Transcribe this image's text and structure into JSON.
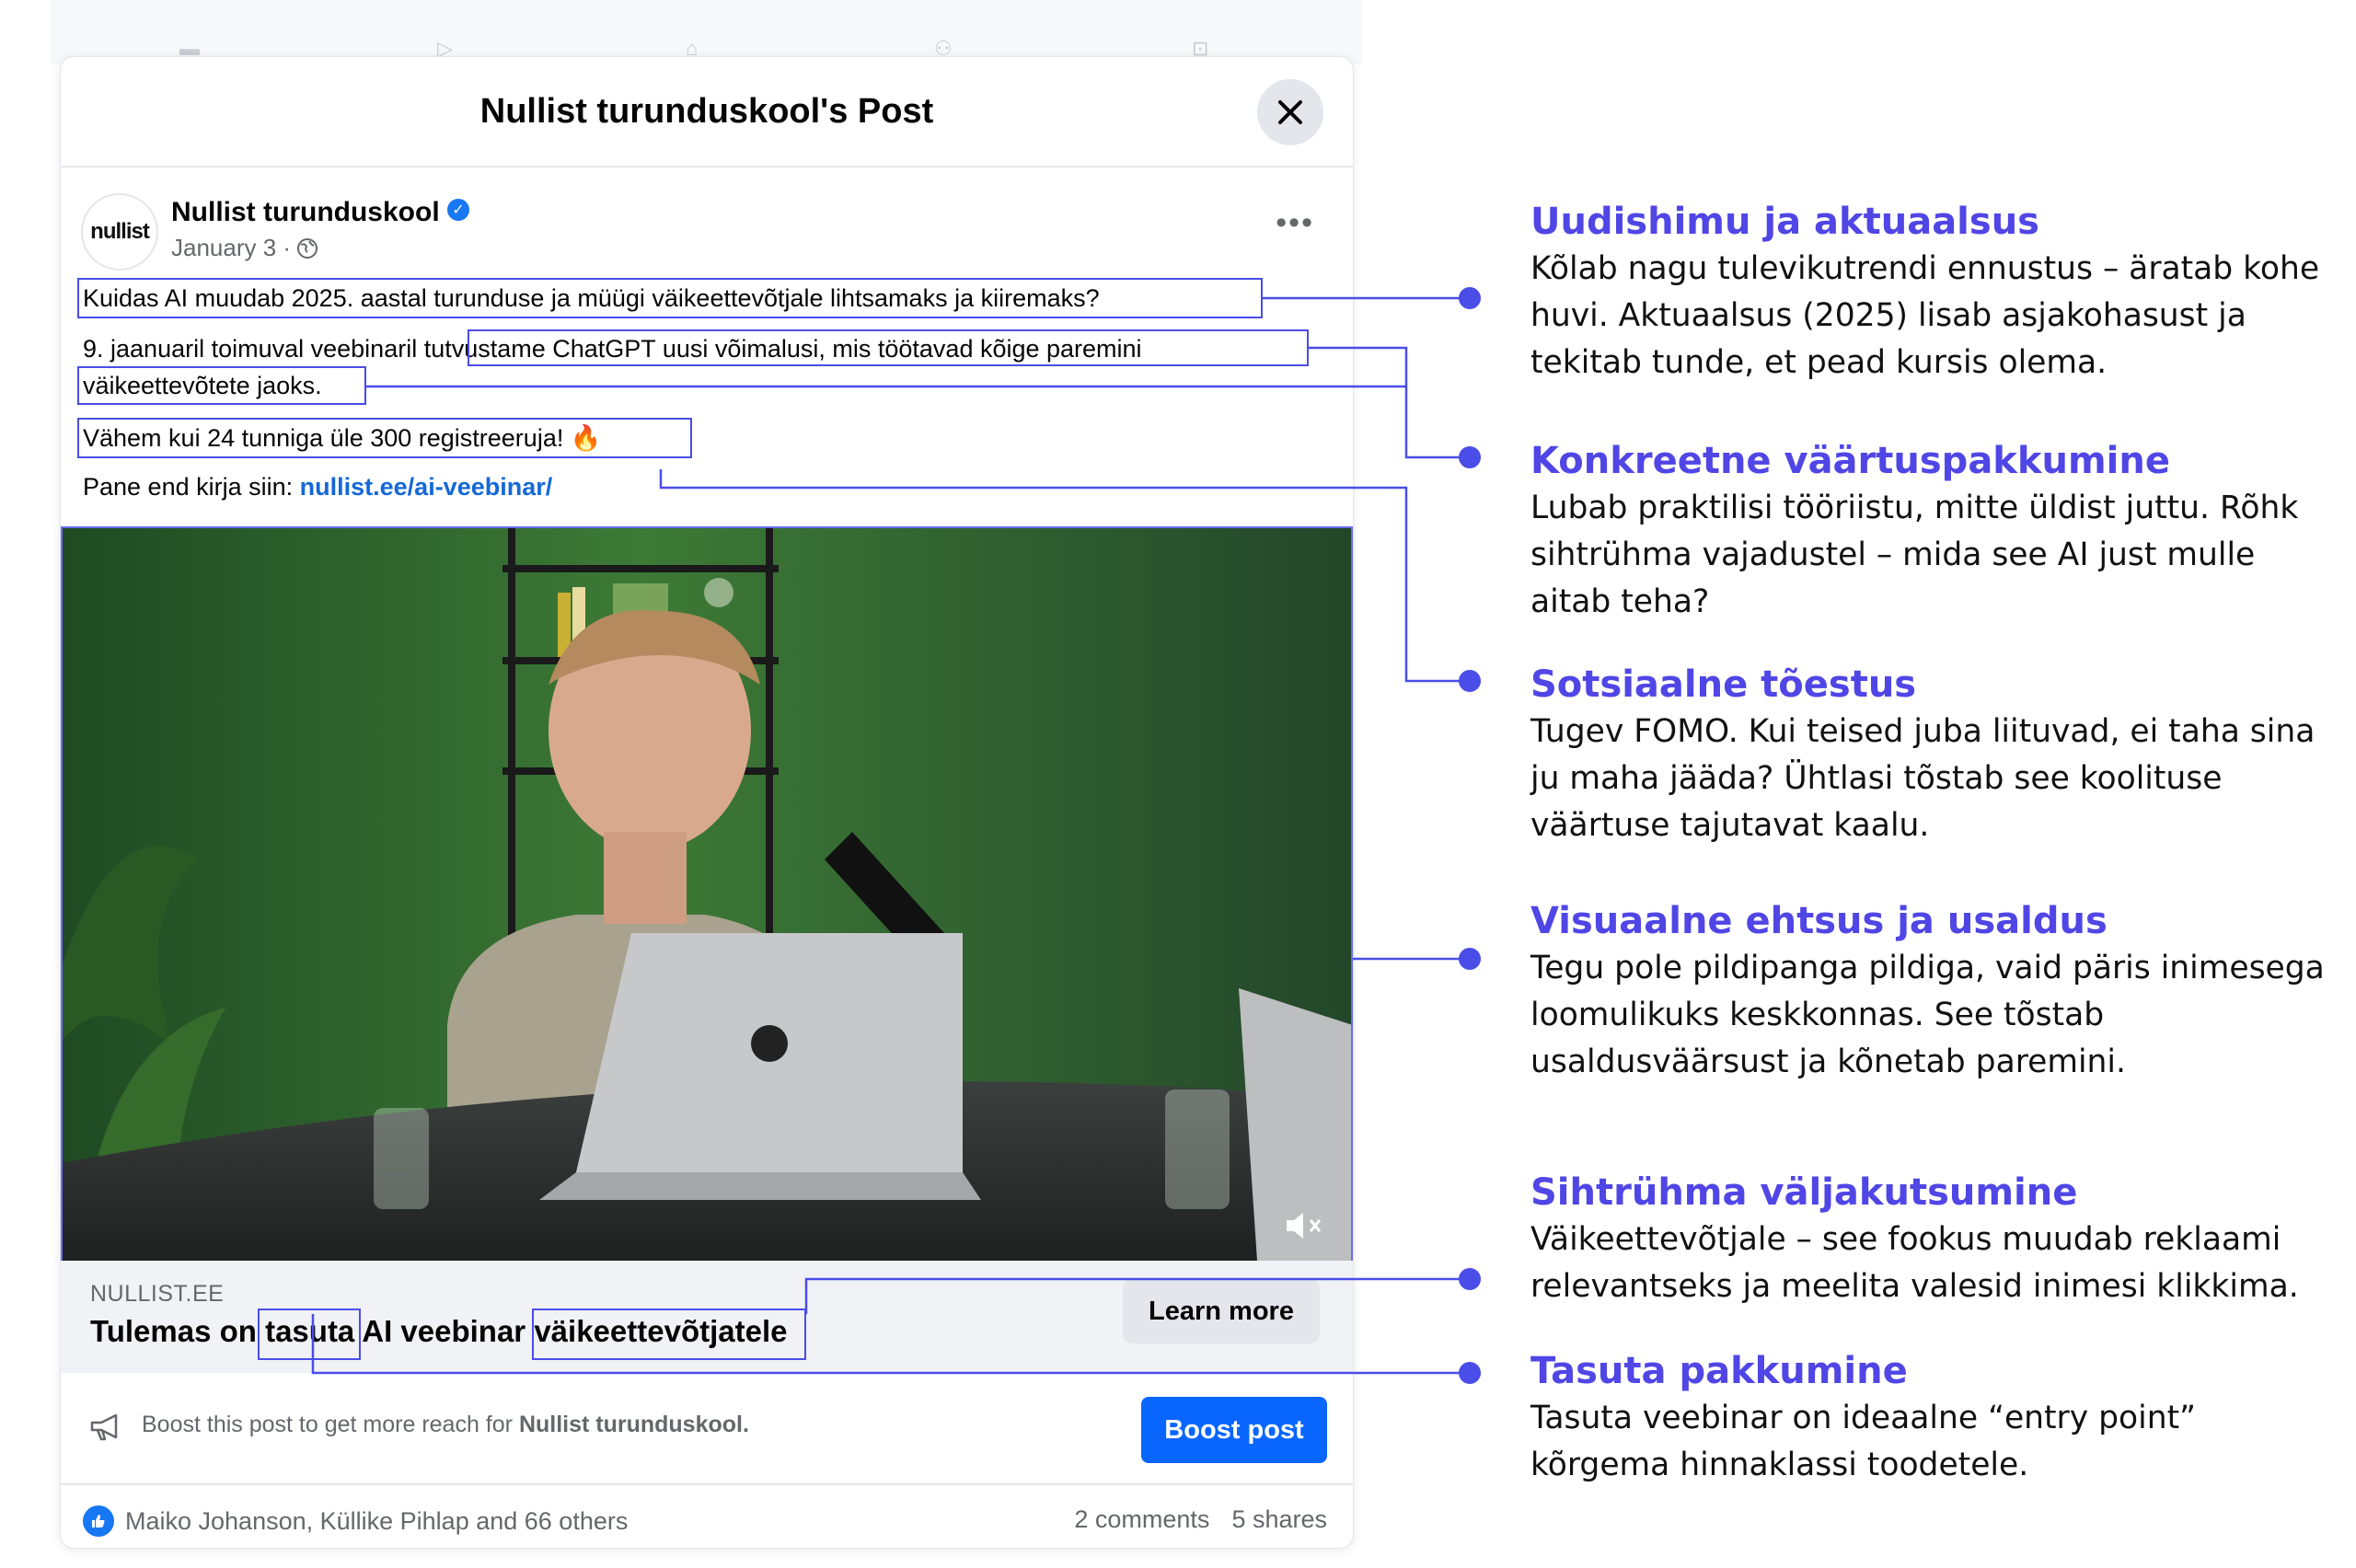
{
  "modal": {
    "title": "Nullist turunduskool's Post",
    "close_icon": "close-icon"
  },
  "post": {
    "avatar_text": "nullist",
    "page_name": "Nullist turunduskool",
    "date": "January 3 ·",
    "privacy_icon": "globe-icon",
    "line1": "Kuidas AI muudab 2025. aastal turunduse ja müügi väikeettevõtjale lihtsamaks ja kiiremaks?",
    "line2a": "9. jaanuaril toimuval veebinaril ",
    "line2b": "tutvustame ChatGPT uusi võimalusi, mis töötavad kõige paremini",
    "line3": "väikeettevõtete jaoks.",
    "line4": "Vähem kui 24 tunniga üle 300 registreeruja! 🔥",
    "line5_prefix": "Pane end kirja siin: ",
    "line5_link": "nullist.ee/ai-veebinar/"
  },
  "link_card": {
    "domain": "NULLIST.EE",
    "title_part1": "Tulemas on ",
    "title_part2": "tasuta",
    "title_part3": " AI veebinar ",
    "title_part4": "väikeettevõtjatele",
    "learn_more": "Learn more"
  },
  "boost": {
    "text_prefix": "Boost this post to get more reach for ",
    "text_page": "Nullist turunduskool.",
    "button": "Boost post"
  },
  "reactions": {
    "names": "Maiko Johanson, Küllike Pihlap and 66 others",
    "comments": "2 comments",
    "shares": "5 shares"
  },
  "annotations": [
    {
      "title": "Uudishimu ja aktuaalsus",
      "body": "Kõlab nagu tulevikutrendi ennustus – äratab kohe huvi. Aktuaalsus (2025) lisab asjakohasust ja tekitab tunde, et pead kursis olema."
    },
    {
      "title": "Konkreetne väärtuspakkumine",
      "body": "Lubab praktilisi tööriistu, mitte üldist juttu. Rõhk sihtrühma vajadustel – mida see AI just mulle aitab teha?"
    },
    {
      "title": "Sotsiaalne tõestus",
      "body": "Tugev FOMO. Kui teised juba liituvad, ei taha sina ju maha jääda? Ühtlasi tõstab see koolituse väärtuse tajutavat kaalu."
    },
    {
      "title": "Visuaalne ehtsus ja usaldus",
      "body": "Tegu pole pildipanga pildiga, vaid päris inimesega loomulikuks keskkonnas. See tõstab usaldusväärsust ja kõnetab paremini."
    },
    {
      "title": "Sihtrühma väljakutsumine",
      "body": "Väikeettevõtjale – see fookus muudab reklaami relevantseks ja meelita valesid inimesi klikkima."
    },
    {
      "title": "Tasuta pakkumine",
      "body": "Tasuta veebinar on ideaalne “entry point” kõrgema hinnaklassi toodetele."
    }
  ],
  "colors": {
    "accent": "#5046e5",
    "highlight_border": "#4a4de8",
    "facebook_blue": "#0866ff"
  }
}
